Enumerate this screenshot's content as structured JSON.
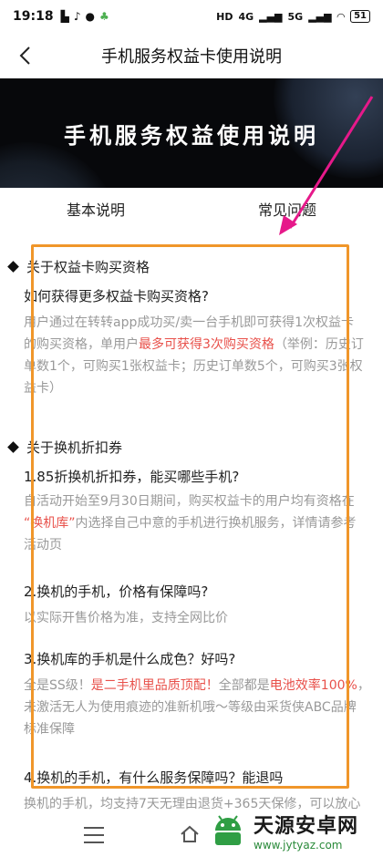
{
  "status_bar": {
    "time": "19:18",
    "network_1": "HD",
    "network_2": "4G",
    "network_3": "5G",
    "battery": "51"
  },
  "nav": {
    "title": "手机服务权益卡使用说明"
  },
  "banner": {
    "title": "手机服务权益使用说明"
  },
  "tabs": [
    {
      "label": "基本说明"
    },
    {
      "label": "常见问题"
    }
  ],
  "sections": [
    {
      "title": "关于权益卡购买资格",
      "items": [
        {
          "question": "如何获得更多权益卡购买资格?",
          "answer_lines": [
            [
              "用户通过在转转app成功买/卖一台手机即可获得1次权益卡"
            ],
            [
              "的购买资格，单用户",
              "最多可获得3次购买资格",
              "（举例：历史订"
            ],
            [
              "单数1个，可购买1张权益卡；历史订单数5个，可购买3张权"
            ],
            [
              "益卡）"
            ]
          ]
        }
      ]
    },
    {
      "title": "关于换机折扣券",
      "items": [
        {
          "question": "1.85折换机折扣券，能买哪些手机?",
          "answer_lines": [
            [
              "自活动开始至9月30日期间，购买权益卡的用户均有资格在"
            ],
            [
              "“换机库”",
              "内选择自己中意的手机进行换机服务，详情请参考"
            ],
            [
              "活动页"
            ]
          ]
        },
        {
          "question": "2.换机的手机，价格有保障吗?",
          "answer_lines": [
            [
              "以实际开售价格为准，支持全网比价"
            ]
          ]
        },
        {
          "question": "3.换机库的手机是什么成色？好吗?",
          "answer_lines": [
            [
              "全是SS级！",
              "是二手机里品质顶配！",
              "全部都是",
              "电池效率100%",
              "，"
            ],
            [
              "未激活无人为使用痕迹的准新机哦～等级由采货侠ABC品牌"
            ],
            [
              "标准保障"
            ]
          ]
        },
        {
          "question": "4.换机的手机，有什么服务保障吗？能退吗",
          "answer_lines": [
            [
              "换机的手机，均支持7天无理由退货+365天保修，可以放心"
            ]
          ]
        }
      ]
    }
  ],
  "watermark": {
    "name": "天源安卓网",
    "url": "www.jytyaz.com"
  },
  "colors": {
    "accent_red": "#e8504a",
    "highlight_orange": "#f0962a",
    "arrow_magenta": "#e6198a",
    "banner_bg": "#07080b"
  }
}
